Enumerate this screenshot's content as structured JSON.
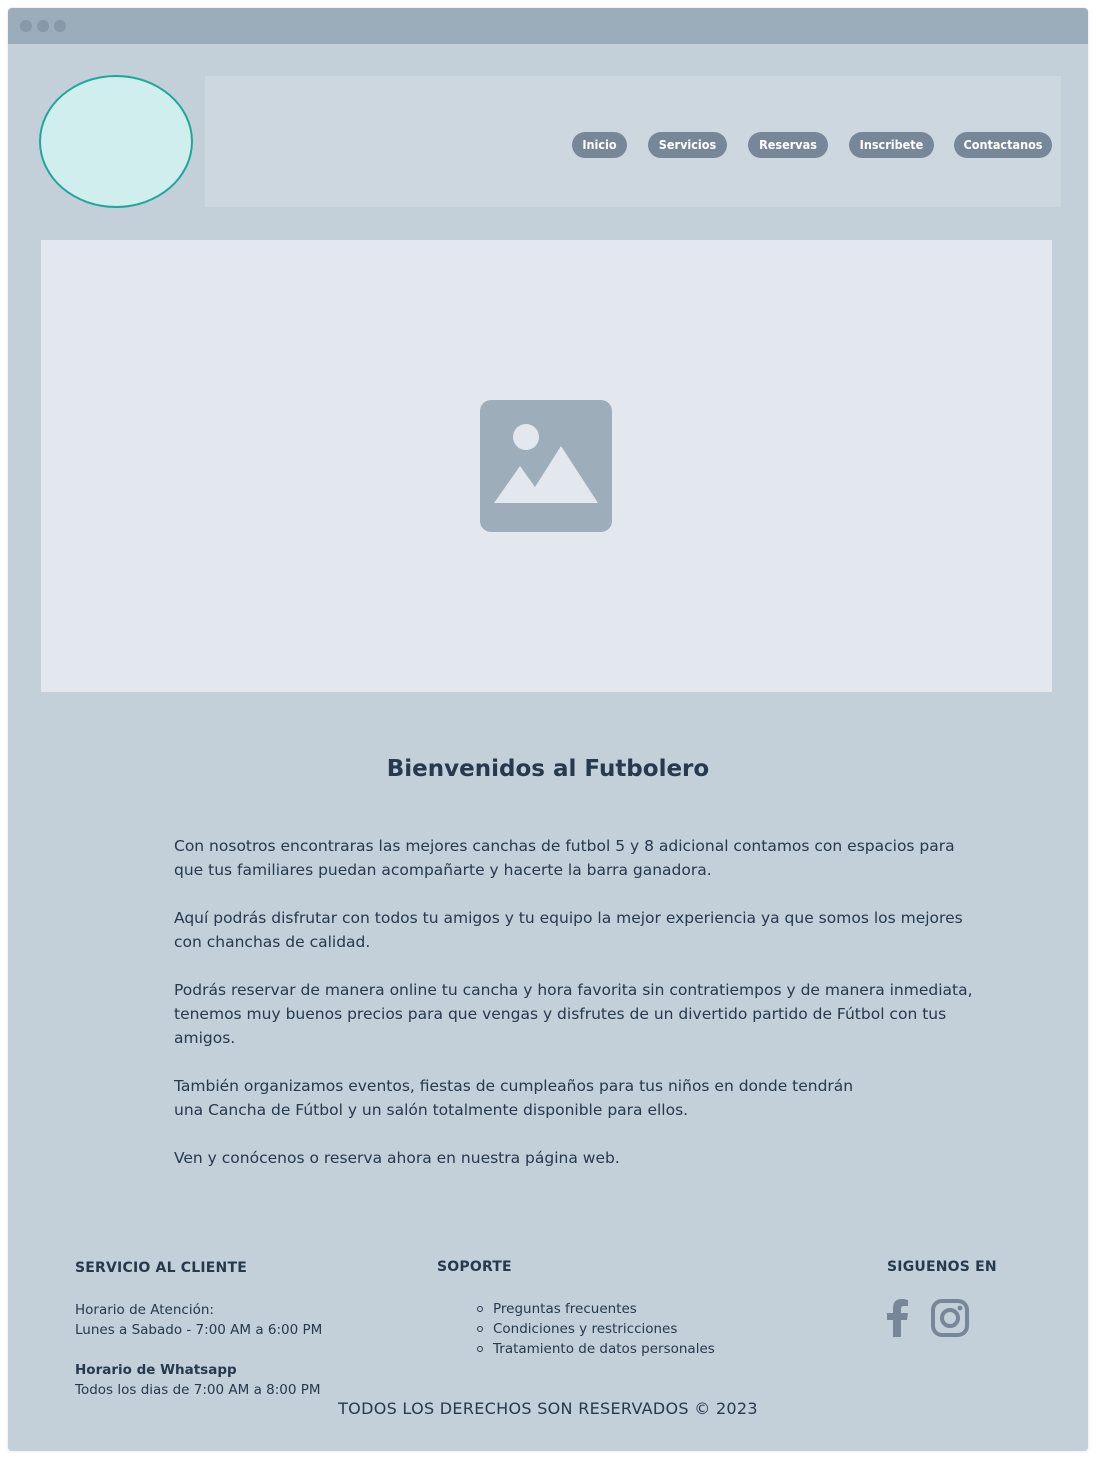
{
  "nav": {
    "items": [
      {
        "label": "Inicio"
      },
      {
        "label": "Servicios"
      },
      {
        "label": "Reservas"
      },
      {
        "label": "Inscribete"
      },
      {
        "label": "Contactanos"
      }
    ]
  },
  "hero": {
    "icon": "image-placeholder-icon"
  },
  "welcome": {
    "title": "Bienvenidos al Futbolero",
    "paragraphs": [
      "Con nosotros encontraras las mejores canchas de futbol 5 y 8 adicional contamos con espacios para\nque tus familiares puedan acompañarte y hacerte la barra ganadora.",
      "Aquí podrás disfrutar con todos tu amigos y tu equipo la mejor experiencia ya que somos los mejores\ncon chanchas de calidad.",
      "Podrás reservar de manera online tu cancha y hora favorita sin contratiempos y de manera inmediata,\ntenemos muy buenos precios para que vengas y disfrutes de un divertido partido de Fútbol con tus\namigos.",
      "También organizamos eventos, fiestas de cumpleaños para tus niños en donde tendrán\nuna Cancha de Fútbol  y un salón totalmente disponible para ellos.",
      "Ven y conócenos o reserva ahora en  nuestra página web."
    ]
  },
  "footer": {
    "customer_service": {
      "heading": "SERVICIO AL CLIENTE",
      "hours_label": "Horario de Atención:",
      "hours_value": "Lunes a Sabado - 7:00 AM a 6:00 PM",
      "whatsapp_label": "Horario de Whatsapp",
      "whatsapp_value": "Todos los dias de 7:00 AM a 8:00 PM"
    },
    "support": {
      "heading": "SOPORTE",
      "items": [
        "Preguntas frecuentes",
        "Condiciones y restricciones",
        "Tratamiento de datos personales"
      ]
    },
    "social": {
      "heading": "SIGUENOS EN",
      "icons": [
        "facebook-icon",
        "instagram-icon"
      ]
    },
    "copyright": "TODOS LOS DERECHOS SON RESERVADOS © 2023"
  },
  "colors": {
    "background": "#c3cfd9",
    "titlebar": "#9badbb",
    "nav_button": "#778797",
    "logo_fill": "#d0eeee",
    "logo_border": "#1fa89a",
    "hero": "#e2e8ed",
    "text": "#26394d"
  }
}
